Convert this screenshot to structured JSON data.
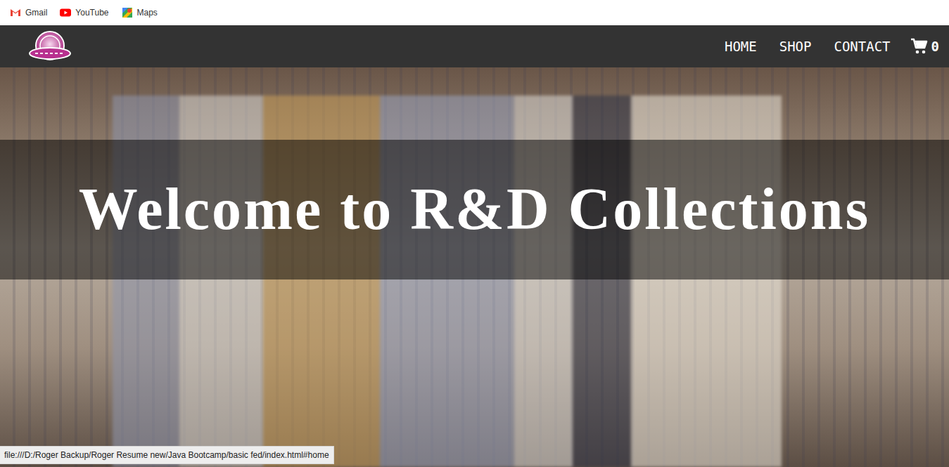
{
  "bookmarks": [
    {
      "label": "Gmail",
      "kind": "gmail"
    },
    {
      "label": "YouTube",
      "kind": "youtube"
    },
    {
      "label": "Maps",
      "kind": "maps"
    }
  ],
  "nav": {
    "links": [
      {
        "label": "HOME",
        "selected": false
      },
      {
        "label": "SHOP",
        "selected": false
      },
      {
        "label": "CONTACT",
        "selected": false
      }
    ],
    "cart_count": "0"
  },
  "hero": {
    "title": "Welcome to R&D Collections"
  },
  "status_bar": "file:///D:/Roger Backup/Roger Resume new/Java Bootcamp/basic fed/index.html#home"
}
